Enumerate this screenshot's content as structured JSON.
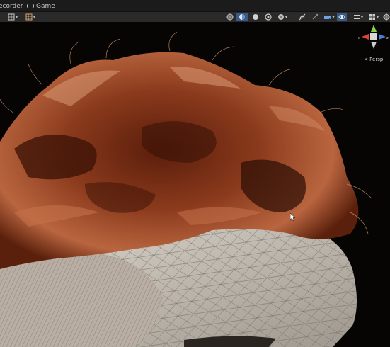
{
  "tabs": [
    {
      "label": "ecorder"
    },
    {
      "label": "Game"
    }
  ],
  "toolbar": {
    "left_tools": [
      {
        "icon": "move-grid-icon"
      },
      {
        "icon": "snap-grid-icon"
      }
    ],
    "right_tools": [
      {
        "icon": "global-icon"
      },
      {
        "icon": "lighting-icon",
        "active": true
      },
      {
        "icon": "shading-sphere-icon"
      },
      {
        "icon": "audio-icon"
      },
      {
        "icon": "effects-icon"
      },
      {
        "icon": "hidden-objects-icon"
      },
      {
        "icon": "tools-icon"
      },
      {
        "icon": "visibility-eye-icon",
        "active": true
      },
      {
        "icon": "camera-icon"
      },
      {
        "icon": "layers-icon"
      },
      {
        "icon": "gizmos-icon"
      }
    ]
  },
  "viewport": {
    "projection_label": "< Persp",
    "gizmo_axes": {
      "x": "x",
      "z": "z"
    }
  },
  "colors": {
    "tabbar": "#1b1b1b",
    "toolbar": "#2a2a2a",
    "active_button": "#3a5a86",
    "hair_dark": "#3a1206",
    "hair_mid": "#8a3a1c",
    "hair_light": "#c97a55",
    "mesh_fill": "#cfc8be",
    "mesh_wire": "#6f6a63",
    "axis_x": "#d9443c",
    "axis_y": "#8acf4b",
    "axis_z": "#4c7ad9"
  }
}
